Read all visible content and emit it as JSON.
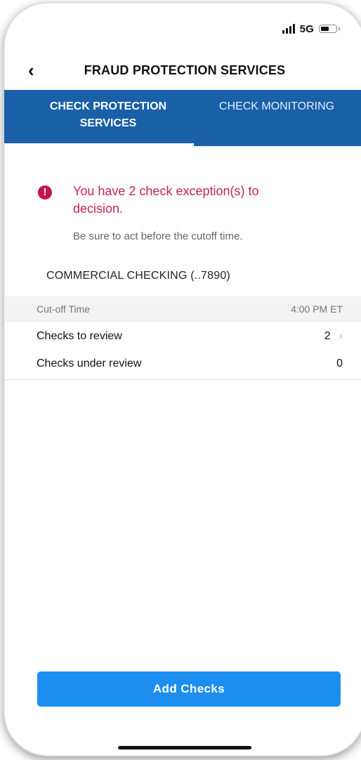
{
  "status_bar": {
    "network": "5G",
    "signal_icon": "signal-bars-icon",
    "battery_icon": "battery-icon"
  },
  "nav": {
    "back_icon": "‹",
    "title": "FRAUD PROTECTION SERVICES"
  },
  "tabs": [
    {
      "label": "CHECK PROTECTION SERVICES",
      "active": true
    },
    {
      "label": "CHECK MONITORING",
      "active": false
    }
  ],
  "alert": {
    "icon": "!",
    "title": "You have 2 check exception(s) to decision.",
    "subtitle": "Be sure to act before the cutoff time."
  },
  "account": {
    "name": "COMMERCIAL CHECKING (..7890)"
  },
  "rows": {
    "cutoff": {
      "label": "Cut-off Time",
      "value": "4:00 PM ET"
    },
    "to_review": {
      "label": "Checks to review",
      "value": "2"
    },
    "under_review": {
      "label": "Checks under review",
      "value": "0"
    }
  },
  "actions": {
    "add_checks": "Add Checks"
  },
  "colors": {
    "tab_bar": "#1960a8",
    "alert": "#c0245a",
    "primary_button": "#1b8ef0"
  }
}
